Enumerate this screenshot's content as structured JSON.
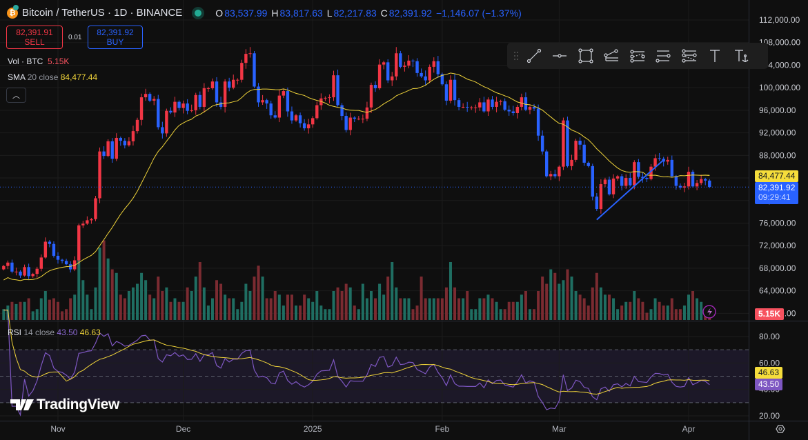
{
  "header": {
    "title": "Bitcoin / TetherUS · 1D · BINANCE",
    "ohlc": {
      "o_label": "O",
      "o": "83,537.99",
      "h_label": "H",
      "h": "83,817.63",
      "l_label": "L",
      "l": "82,217.83",
      "c_label": "C",
      "c": "82,391.92",
      "change": "−1,146.07 (−1.37%)"
    },
    "sell_price": "82,391.91",
    "sell_label": "SELL",
    "spread": "0.01",
    "buy_price": "82,391.92",
    "buy_label": "BUY"
  },
  "indicators": {
    "vol_name": "Vol · BTC",
    "vol_value": "5.15K",
    "sma_name": "SMA",
    "sma_params": "20 close",
    "sma_value": "84,477.44",
    "rsi_name": "RSI",
    "rsi_params": "14 close",
    "rsi_value": "43.50",
    "rsi_ma_value": "46.63"
  },
  "toolbar": {
    "tools": [
      "drag-handle",
      "trend-line",
      "horizontal-ray",
      "rectangle",
      "pitchfork",
      "parallel-channel",
      "horizontal-lines",
      "fib-channel",
      "text",
      "anchored-text"
    ]
  },
  "watermark": "TradingView",
  "price_labels": {
    "sma": "84,477.44",
    "last": "82,391.92",
    "countdown": "09:29:41",
    "volume": "5.15K",
    "rsi_ma": "46.63",
    "rsi": "43.50"
  },
  "colors": {
    "up": "#f23645",
    "down": "#2962ff",
    "vol_up": "#1f6e62",
    "vol_down": "#7b2b31",
    "sma": "#f0d43a",
    "rsi": "#7e57c2",
    "rsi_ma": "#f0d43a",
    "background": "#0f0f0f"
  },
  "chart_data": {
    "type": "candlestick",
    "symbol": "Bitcoin / TetherUS",
    "interval": "1D",
    "x_ticks": [
      "Nov",
      "Dec",
      "2025",
      "Feb",
      "Mar",
      "Apr"
    ],
    "x_start": "2024-10-19",
    "x_end": "2025-04-06",
    "price_ticks": [
      "112,000.00",
      "108,000.00",
      "104,000.00",
      "100,000.00",
      "96,000.00",
      "92,000.00",
      "88,000.00",
      "84,000.00",
      "80,000.00",
      "76,000.00",
      "72,000.00",
      "68,000.00",
      "64,000.00",
      "60,000.00"
    ],
    "price_tick_values": [
      112000,
      108000,
      104000,
      100000,
      96000,
      92000,
      88000,
      84000,
      80000,
      76000,
      72000,
      68000,
      64000,
      60000
    ],
    "rsi_ticks": [
      "80.00",
      "60.00",
      "40.00",
      "20.00"
    ],
    "rsi_tick_values": [
      80,
      60,
      40,
      20
    ],
    "rsi_bands": [
      70,
      50,
      30
    ],
    "last_candle": {
      "open": 83537.99,
      "high": 83817.63,
      "low": 82217.83,
      "close": 82391.92
    },
    "closes": [
      68400,
      69000,
      67400,
      67400,
      66700,
      68200,
      66600,
      67000,
      67900,
      69900,
      72700,
      72300,
      70200,
      69500,
      69300,
      68700,
      67800,
      69400,
      75600,
      75900,
      76500,
      76700,
      80400,
      88700,
      87900,
      90500,
      87400,
      91100,
      90600,
      89800,
      90500,
      92300,
      94300,
      98300,
      98900,
      97700,
      98000,
      93000,
      91900,
      95900,
      95600,
      97500,
      96400,
      97200,
      95900,
      96000,
      98700,
      96600,
      99900,
      99900,
      101100,
      97400,
      96600,
      101100,
      100000,
      101400,
      101400,
      104400,
      106000,
      106100,
      100200,
      97400,
      97800,
      97200,
      95100,
      94700,
      98600,
      99400,
      95800,
      94200,
      95100,
      93700,
      92800,
      93500,
      94600,
      96900,
      98100,
      98200,
      98300,
      102200,
      96900,
      95000,
      92500,
      94700,
      94500,
      94500,
      94500,
      96500,
      100500,
      99900,
      104100,
      104500,
      101300,
      102000,
      106100,
      103700,
      103900,
      104800,
      104700,
      102600,
      102000,
      101300,
      103700,
      104700,
      102400,
      100600,
      97700,
      101400,
      97800,
      96600,
      96600,
      96500,
      96500,
      96500,
      97400,
      95800,
      97900,
      96600,
      97500,
      97600,
      96100,
      95800,
      95500,
      96600,
      98300,
      96100,
      96600,
      96300,
      91500,
      88700,
      84300,
      84700,
      84300,
      86000,
      94200,
      86100,
      87200,
      90600,
      89900,
      86700,
      86100,
      80700,
      78500,
      82900,
      83700,
      81100,
      83900,
      84300,
      82600,
      84000,
      82700,
      86800,
      84200,
      84000,
      83800,
      86000,
      87500,
      87400,
      86900,
      87200,
      84300,
      82600,
      82300,
      82500,
      85100,
      82500,
      83100,
      83800,
      83537.99,
      82391.92
    ],
    "volumes_k": [
      15,
      20,
      25,
      22,
      25,
      25,
      30,
      12,
      15,
      30,
      40,
      28,
      30,
      25,
      12,
      15,
      30,
      35,
      90,
      55,
      35,
      15,
      45,
      100,
      110,
      85,
      70,
      65,
      35,
      30,
      40,
      45,
      50,
      65,
      55,
      35,
      30,
      60,
      40,
      45,
      25,
      30,
      25,
      25,
      45,
      40,
      60,
      80,
      45,
      20,
      30,
      55,
      50,
      35,
      30,
      30,
      15,
      25,
      50,
      40,
      60,
      75,
      60,
      30,
      30,
      40,
      35,
      20,
      35,
      35,
      20,
      20,
      35,
      30,
      25,
      40,
      20,
      15,
      15,
      40,
      45,
      40,
      50,
      45,
      20,
      15,
      50,
      30,
      40,
      30,
      50,
      35,
      60,
      80,
      45,
      30,
      30,
      30,
      15,
      20,
      60,
      30,
      30,
      30,
      30,
      30,
      45,
      80,
      45,
      30,
      30,
      40,
      15,
      15,
      30,
      30,
      35,
      30,
      25,
      15,
      15,
      25,
      25,
      25,
      35,
      40,
      15,
      15,
      40,
      60,
      50,
      70,
      65,
      50,
      55,
      70,
      60,
      40,
      35,
      30,
      20,
      45,
      65,
      45,
      35,
      35,
      30,
      15,
      20,
      25,
      25,
      40,
      30,
      25,
      10,
      15,
      30,
      25,
      20,
      20,
      30,
      15,
      15,
      20,
      35,
      40,
      30,
      25,
      15,
      5.15
    ],
    "sma_period": 20,
    "rsi_period": 14,
    "rsi_ma_period": 14,
    "trend_line": {
      "from": {
        "date": "2025-03-10",
        "price": 76600
      },
      "to": {
        "date": "2025-03-26",
        "price": 87200
      }
    },
    "price_range": [
      60000,
      112000
    ],
    "rsi_range": [
      20,
      80
    ],
    "grid": true
  }
}
